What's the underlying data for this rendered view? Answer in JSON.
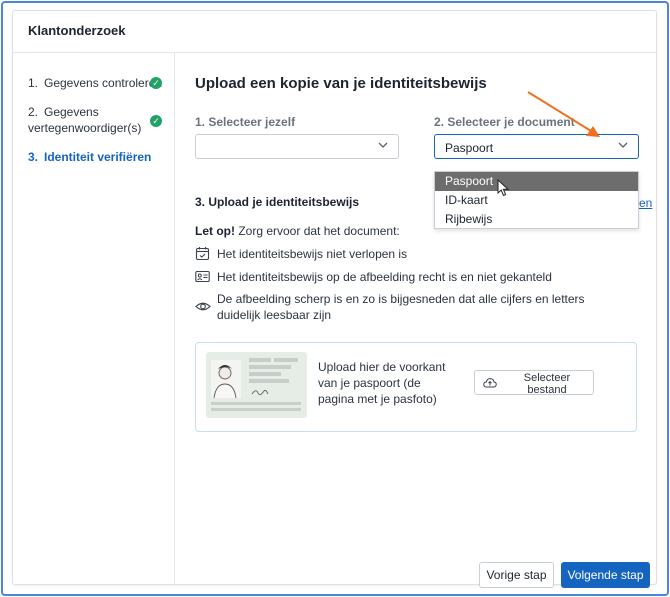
{
  "header": {
    "title": "Klantonderzoek"
  },
  "sidebar": {
    "steps": [
      {
        "num": "1.",
        "label": "Gegevens controleren"
      },
      {
        "num": "2.",
        "label_line1": "Gegevens",
        "label_line2": "vertegenwoordiger(s)"
      },
      {
        "num": "3.",
        "label": "Identiteit verifiëren"
      }
    ]
  },
  "main": {
    "title": "Upload een kopie van je identiteitsbewijs",
    "field1": {
      "label": "1. Selecteer jezelf",
      "value": ""
    },
    "field2": {
      "label": "2. Selecteer je document",
      "value": "Paspoort"
    },
    "dropdown_options": [
      "Paspoort",
      "ID-kaart",
      "Rijbewijs"
    ],
    "section_title": "3. Upload je identiteitsbewijs",
    "link_fragment": "en",
    "note_bold": "Let op!",
    "note_rest": " Zorg ervoor dat het document:",
    "requirements": [
      "Het identiteitsbewijs niet verlopen is",
      "Het identiteitsbewijs op de afbeelding recht is en niet gekanteld",
      "De afbeelding scherp is en zo is bijgesneden dat alle cijfers en letters duidelijk leesbaar zijn"
    ],
    "upload": {
      "text": "Upload hier de voorkant van je paspoort (de pagina met je pasfoto)",
      "button_line1": "Selecteer",
      "button_line2": "bestand"
    }
  },
  "footer": {
    "prev_label": "Vorige stap",
    "next_label": "Volgende stap"
  },
  "colors": {
    "accent": "#1565c0",
    "success": "#21a366",
    "annotation": "#f07020"
  }
}
